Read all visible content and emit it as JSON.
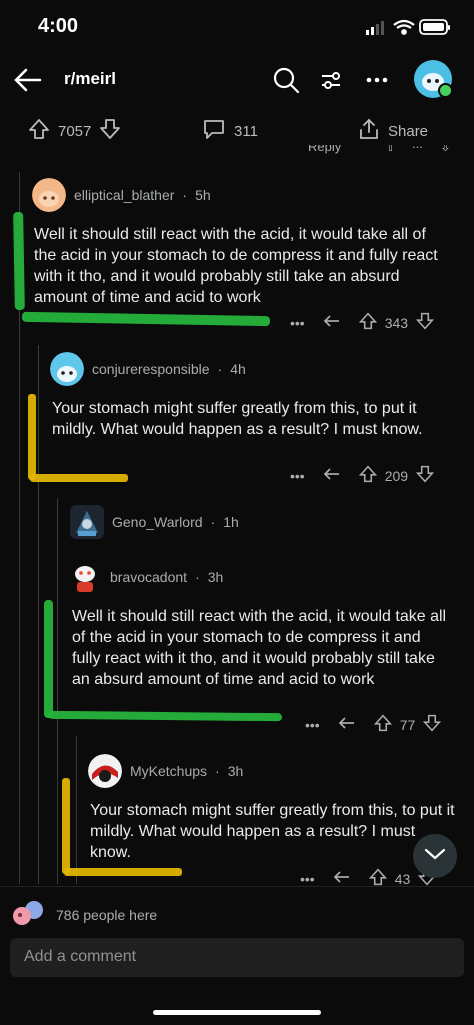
{
  "status_bar": {
    "time": "4:00"
  },
  "header": {
    "subreddit": "r/meirl"
  },
  "post_actions": {
    "upvotes": "7057",
    "comments": "311",
    "share_label": "Share"
  },
  "partial_reply_label": "Reply",
  "comments": [
    {
      "author": "elliptical_blather",
      "age": "5h",
      "text": "Well it should still react with the acid, it would take all of the acid in your stomach to de compress it and fully react with it tho, and it would probably still take an absurd amount of time and acid to work",
      "score": "343"
    },
    {
      "author": "conjureresponsible",
      "age": "4h",
      "text": "Your stomach might suffer greatly from this, to put it mildly. What would happen as a result? I must know.",
      "score": "209"
    },
    {
      "author": "Geno_Warlord",
      "age": "1h"
    },
    {
      "author": "bravocadont",
      "age": "3h",
      "text": "Well it should still react with the acid, it would take all of the acid in your stomach to de compress it and fully react with it tho, and it would probably still take an absurd amount of time and acid to work",
      "score": "77"
    },
    {
      "author": "MyKetchups",
      "age": "3h",
      "text": "Your stomach might suffer greatly from this, to put it mildly. What would happen as a result? I must know.",
      "score": "43"
    }
  ],
  "footer": {
    "people_here": "786 people here",
    "comment_placeholder": "Add a comment"
  },
  "colors": {
    "background": "#0b0b0b",
    "green_marker": "#26b43c",
    "yellow_marker": "#e1b400"
  },
  "icons": [
    "back-arrow-icon",
    "search-icon",
    "filter-icon",
    "more-icon",
    "upvote-icon",
    "downvote-icon",
    "comment-icon",
    "share-icon",
    "reply-icon",
    "chevron-down-icon"
  ]
}
